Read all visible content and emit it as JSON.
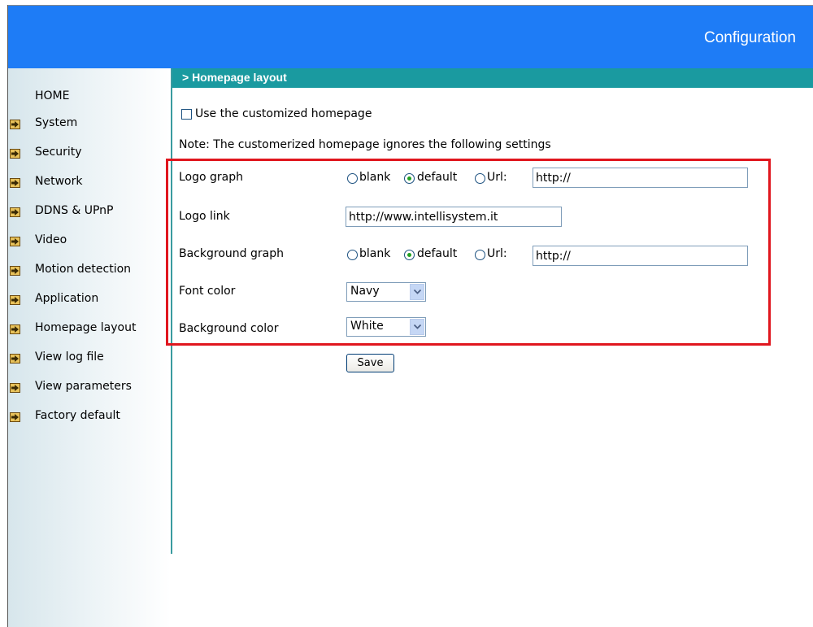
{
  "header": {
    "title": "Configuration"
  },
  "sidebar": {
    "home_label": "HOME",
    "items": [
      {
        "label": "System"
      },
      {
        "label": "Security"
      },
      {
        "label": "Network"
      },
      {
        "label": "DDNS & UPnP"
      },
      {
        "label": "Video"
      },
      {
        "label": "Motion detection"
      },
      {
        "label": "Application"
      },
      {
        "label": "Homepage layout"
      },
      {
        "label": "View log file"
      },
      {
        "label": "View parameters"
      },
      {
        "label": "Factory default"
      }
    ]
  },
  "section": {
    "title": "> Homepage layout"
  },
  "form": {
    "custom_homepage_label": "Use the customized homepage",
    "note": "Note: The customerized homepage ignores the following settings",
    "logo_graph": {
      "label": "Logo graph",
      "option_blank": "blank",
      "option_default": "default",
      "option_url": "Url:",
      "selected": "default",
      "url_value": "http://"
    },
    "logo_link": {
      "label": "Logo link",
      "value": "http://www.intellisystem.it"
    },
    "background_graph": {
      "label": "Background graph",
      "option_blank": "blank",
      "option_default": "default",
      "option_url": "Url:",
      "selected": "default",
      "url_value": "http://"
    },
    "font_color": {
      "label": "Font color",
      "value": "Navy"
    },
    "background_color": {
      "label": "Background color",
      "value": "White"
    },
    "save_label": "Save"
  },
  "colors": {
    "header_blue": "#1e7cf6",
    "section_teal": "#1a9aa0",
    "highlight_red": "#e0161e"
  }
}
